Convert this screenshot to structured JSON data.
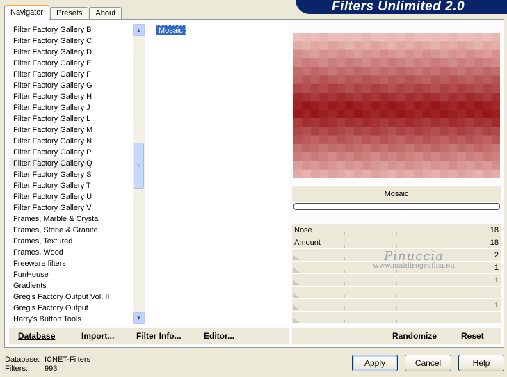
{
  "tabs": [
    "Navigator",
    "Presets",
    "About"
  ],
  "banner": {
    "title": "Filters Unlimited 2.0"
  },
  "categories": [
    "Filter Factory Gallery B",
    "Filter Factory Gallery C",
    "Filter Factory Gallery D",
    "Filter Factory Gallery E",
    "Filter Factory Gallery F",
    "Filter Factory Gallery G",
    "Filter Factory Gallery H",
    "Filter Factory Gallery J",
    "Filter Factory Gallery L",
    "Filter Factory Gallery M",
    "Filter Factory Gallery N",
    "Filter Factory Gallery P",
    "Filter Factory Gallery Q",
    "Filter Factory Gallery S",
    "Filter Factory Gallery T",
    "Filter Factory Gallery U",
    "Filter Factory Gallery V",
    "Frames, Marble & Crystal",
    "Frames, Stone & Granite",
    "Frames, Textured",
    "Frames, Wood",
    "Freeware filters",
    "FunHouse",
    "Gradients",
    "Greg's Factory Output Vol. II",
    "Greg's Factory Output",
    "Harry's Button Tools"
  ],
  "selected_category": "Filter Factory Gallery Q",
  "filters": [
    "Mosaic"
  ],
  "selected_filter": "Mosaic",
  "preview": {
    "filter_name": "Mosaic"
  },
  "params": [
    {
      "label": "Nose",
      "value": "18"
    },
    {
      "label": "Amount",
      "value": "18"
    },
    {
      "label": "",
      "value": "2"
    },
    {
      "label": "",
      "value": "1"
    },
    {
      "label": "",
      "value": "1"
    },
    {
      "label": "",
      "value": ""
    },
    {
      "label": "",
      "value": "1"
    },
    {
      "label": "",
      "value": ""
    }
  ],
  "actions": {
    "database": "Database",
    "import": "Import...",
    "filter_info": "Filter Info...",
    "editor": "Editor...",
    "randomize": "Randomize",
    "reset": "Reset"
  },
  "footer": {
    "database_label": "Database:",
    "database_value": "ICNET-Filters",
    "filters_label": "Filters:",
    "filters_value": "993"
  },
  "buttons": {
    "apply": "Apply",
    "cancel": "Cancel",
    "help": "Help"
  },
  "watermark": {
    "name": "Pinuccia",
    "site": "www.maidiregrafica.eu"
  },
  "colors": {
    "banner": "#0a246a",
    "selection": "#316ac5",
    "accent_tab": "#f4a733"
  }
}
